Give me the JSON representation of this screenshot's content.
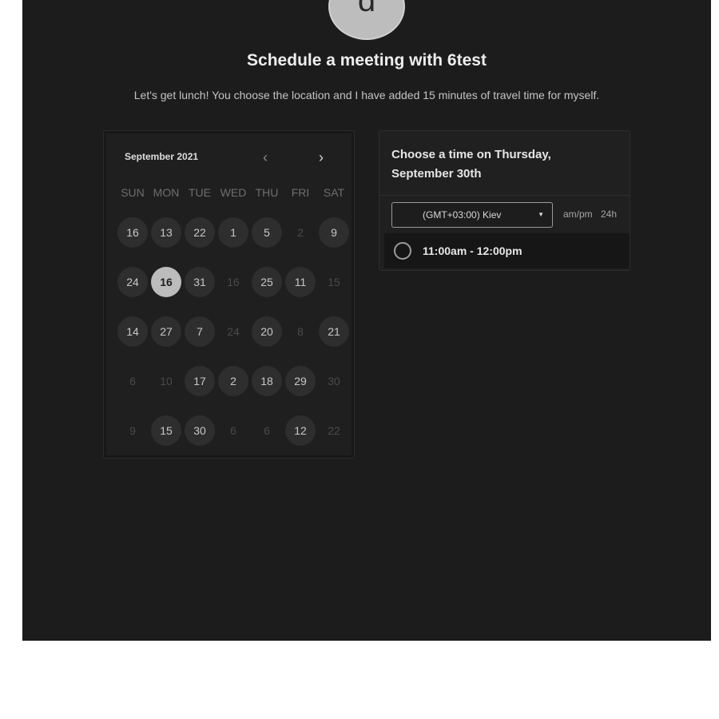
{
  "host": {
    "avatar_letter": "d",
    "title": "Schedule a meeting with 6test",
    "description": "Let's get lunch! You choose the location and I have added 15 minutes of travel time for myself."
  },
  "calendar": {
    "month_label": "September 2021",
    "prev_icon": "chevron-left-icon",
    "next_icon": "chevron-right-icon",
    "weekdays": [
      "SUN",
      "MON",
      "TUE",
      "WED",
      "THU",
      "FRI",
      "SAT"
    ],
    "weeks": [
      [
        {
          "label": "16",
          "available": true
        },
        {
          "label": "13",
          "available": true
        },
        {
          "label": "22",
          "available": true
        },
        {
          "label": "1",
          "available": true
        },
        {
          "label": "5",
          "available": true
        },
        {
          "label": "2",
          "available": false
        },
        {
          "label": "9",
          "available": true
        }
      ],
      [
        {
          "label": "24",
          "available": true
        },
        {
          "label": "16",
          "available": true,
          "selected": true
        },
        {
          "label": "31",
          "available": true
        },
        {
          "label": "16",
          "available": false
        },
        {
          "label": "25",
          "available": true
        },
        {
          "label": "11",
          "available": true
        },
        {
          "label": "15",
          "available": false
        }
      ],
      [
        {
          "label": "14",
          "available": true
        },
        {
          "label": "27",
          "available": true
        },
        {
          "label": "7",
          "available": true
        },
        {
          "label": "24",
          "available": false
        },
        {
          "label": "20",
          "available": true
        },
        {
          "label": "8",
          "available": false
        },
        {
          "label": "21",
          "available": true
        }
      ],
      [
        {
          "label": "6",
          "available": false
        },
        {
          "label": "10",
          "available": false
        },
        {
          "label": "17",
          "available": true
        },
        {
          "label": "2",
          "available": true
        },
        {
          "label": "18",
          "available": true
        },
        {
          "label": "29",
          "available": true
        },
        {
          "label": "30",
          "available": false
        }
      ],
      [
        {
          "label": "9",
          "available": false
        },
        {
          "label": "15",
          "available": true
        },
        {
          "label": "30",
          "available": true
        },
        {
          "label": "6",
          "available": false
        },
        {
          "label": "6",
          "available": false
        },
        {
          "label": "12",
          "available": true
        },
        {
          "label": "22",
          "available": false
        }
      ]
    ]
  },
  "time_panel": {
    "heading": "Choose a time on Thursday, September 30th",
    "timezone": "(GMT+03:00) Kiev",
    "format_ampm": "am/pm",
    "format_24h": "24h",
    "slots": [
      "11:00am - 12:00pm"
    ]
  },
  "colors": {
    "background": "#1c1c1c",
    "available_day": "#2e2e2e",
    "selected_day": "#bcbcbc",
    "heading_text": "#eeeeee"
  }
}
